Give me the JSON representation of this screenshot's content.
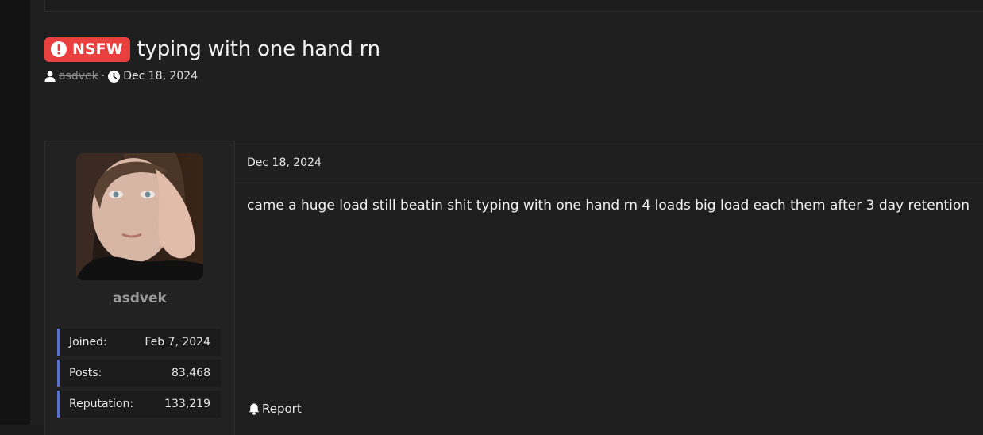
{
  "thread": {
    "badge_label": "NSFW",
    "title": "typing with one hand rn",
    "author": "asdvek",
    "separator": "·",
    "date": "Dec 18, 2024"
  },
  "post": {
    "date": "Dec 18, 2024",
    "body": "came a huge load still beatin shit typing with one hand rn 4 loads big load each them after 3 day retention",
    "report_label": "Report"
  },
  "user": {
    "username": "asdvek",
    "stats": [
      {
        "label": "Joined:",
        "value": "Feb 7, 2024"
      },
      {
        "label": "Posts:",
        "value": "83,468"
      },
      {
        "label": "Reputation:",
        "value": "133,219"
      }
    ]
  },
  "colors": {
    "nsfw_badge": "#e9403f",
    "stat_accent": "#5b6ec9",
    "background": "#1f1f1f"
  },
  "icons": [
    "alert-circle-icon",
    "user-icon",
    "clock-icon",
    "bell-icon"
  ]
}
